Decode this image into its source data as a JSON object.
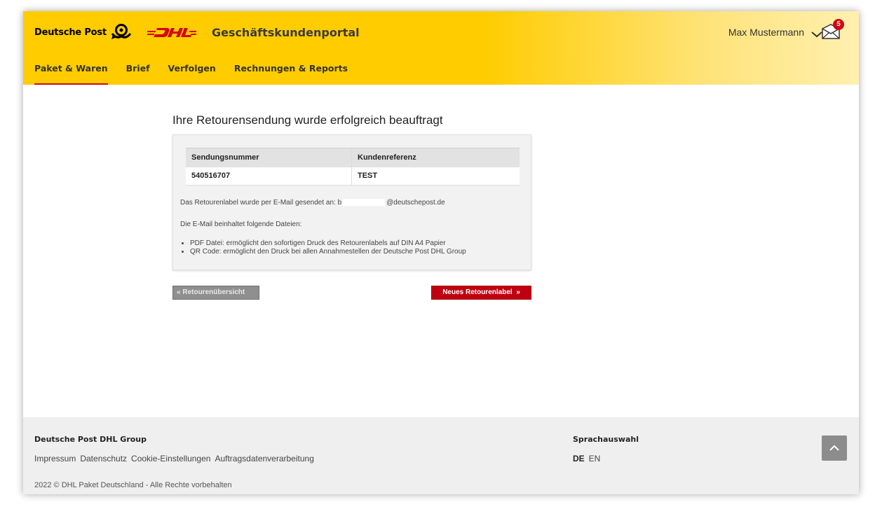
{
  "header": {
    "brand": "Deutsche Post",
    "portal_title": "Geschäftskundenportal",
    "user_name": "Max Mustermann",
    "notification_count": "5",
    "nav": [
      {
        "label": "Paket & Waren",
        "active": true
      },
      {
        "label": "Brief",
        "active": false
      },
      {
        "label": "Verfolgen",
        "active": false
      },
      {
        "label": "Rechnungen & Reports",
        "active": false
      }
    ]
  },
  "main": {
    "title": "Ihre Retourensendung wurde erfolgreich beauftragt",
    "table": {
      "headers": [
        "Sendungsnummer",
        "Kundenreferenz"
      ],
      "rows": [
        [
          "540516707",
          "TEST"
        ]
      ]
    },
    "email_text_prefix": "Das Retourenlabel wurde per E-Mail gesendet an: b",
    "email_text_suffix": "@deutschepost.de",
    "files_intro": "Die E-Mail beinhaltet folgende Dateien:",
    "files": [
      "PDF Datei: ermöglicht den sofortigen Druck des Retourenlabels auf DIN A4 Papier",
      "QR Code: ermöglicht den Druck bei allen Annahmestellen der Deutsche Post DHL Group"
    ],
    "back_button": "Retourenübersicht",
    "new_button": "Neues Retourenlabel"
  },
  "footer": {
    "group": "Deutsche Post DHL Group",
    "links": [
      "Impressum",
      "Datenschutz",
      "Cookie-Einstellungen",
      "Auftragsdatenverarbeitung"
    ],
    "copyright": "2022 © DHL Paket Deutschland - Alle Rechte vorbehalten",
    "language_title": "Sprachauswahl",
    "languages": [
      {
        "code": "DE",
        "active": true
      },
      {
        "code": "EN",
        "active": false
      }
    ]
  },
  "colors": {
    "brand_yellow": "#ffcc00",
    "dhl_red": "#d40511",
    "button_red": "#c00010",
    "button_grey": "#8f8f8f"
  },
  "icons": [
    "posthorn-icon",
    "dhl-logo",
    "chevron-down-icon",
    "mail-icon",
    "double-chevron-left-icon",
    "double-chevron-right-icon",
    "chevron-up-icon"
  ]
}
